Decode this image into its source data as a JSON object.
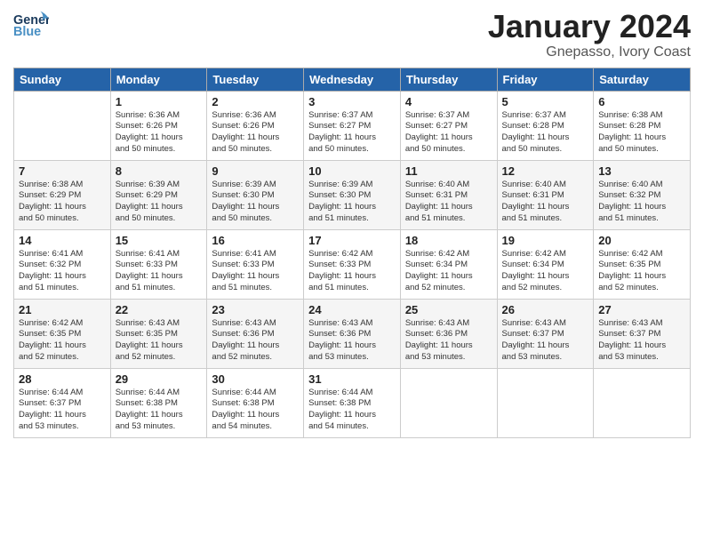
{
  "header": {
    "logo_general": "General",
    "logo_blue": "Blue",
    "title": "January 2024",
    "subtitle": "Gnepasso, Ivory Coast"
  },
  "columns": [
    "Sunday",
    "Monday",
    "Tuesday",
    "Wednesday",
    "Thursday",
    "Friday",
    "Saturday"
  ],
  "weeks": [
    [
      {
        "day": "",
        "info": ""
      },
      {
        "day": "1",
        "info": "Sunrise: 6:36 AM\nSunset: 6:26 PM\nDaylight: 11 hours\nand 50 minutes."
      },
      {
        "day": "2",
        "info": "Sunrise: 6:36 AM\nSunset: 6:26 PM\nDaylight: 11 hours\nand 50 minutes."
      },
      {
        "day": "3",
        "info": "Sunrise: 6:37 AM\nSunset: 6:27 PM\nDaylight: 11 hours\nand 50 minutes."
      },
      {
        "day": "4",
        "info": "Sunrise: 6:37 AM\nSunset: 6:27 PM\nDaylight: 11 hours\nand 50 minutes."
      },
      {
        "day": "5",
        "info": "Sunrise: 6:37 AM\nSunset: 6:28 PM\nDaylight: 11 hours\nand 50 minutes."
      },
      {
        "day": "6",
        "info": "Sunrise: 6:38 AM\nSunset: 6:28 PM\nDaylight: 11 hours\nand 50 minutes."
      }
    ],
    [
      {
        "day": "7",
        "info": "Sunrise: 6:38 AM\nSunset: 6:29 PM\nDaylight: 11 hours\nand 50 minutes."
      },
      {
        "day": "8",
        "info": "Sunrise: 6:39 AM\nSunset: 6:29 PM\nDaylight: 11 hours\nand 50 minutes."
      },
      {
        "day": "9",
        "info": "Sunrise: 6:39 AM\nSunset: 6:30 PM\nDaylight: 11 hours\nand 50 minutes."
      },
      {
        "day": "10",
        "info": "Sunrise: 6:39 AM\nSunset: 6:30 PM\nDaylight: 11 hours\nand 51 minutes."
      },
      {
        "day": "11",
        "info": "Sunrise: 6:40 AM\nSunset: 6:31 PM\nDaylight: 11 hours\nand 51 minutes."
      },
      {
        "day": "12",
        "info": "Sunrise: 6:40 AM\nSunset: 6:31 PM\nDaylight: 11 hours\nand 51 minutes."
      },
      {
        "day": "13",
        "info": "Sunrise: 6:40 AM\nSunset: 6:32 PM\nDaylight: 11 hours\nand 51 minutes."
      }
    ],
    [
      {
        "day": "14",
        "info": "Sunrise: 6:41 AM\nSunset: 6:32 PM\nDaylight: 11 hours\nand 51 minutes."
      },
      {
        "day": "15",
        "info": "Sunrise: 6:41 AM\nSunset: 6:33 PM\nDaylight: 11 hours\nand 51 minutes."
      },
      {
        "day": "16",
        "info": "Sunrise: 6:41 AM\nSunset: 6:33 PM\nDaylight: 11 hours\nand 51 minutes."
      },
      {
        "day": "17",
        "info": "Sunrise: 6:42 AM\nSunset: 6:33 PM\nDaylight: 11 hours\nand 51 minutes."
      },
      {
        "day": "18",
        "info": "Sunrise: 6:42 AM\nSunset: 6:34 PM\nDaylight: 11 hours\nand 52 minutes."
      },
      {
        "day": "19",
        "info": "Sunrise: 6:42 AM\nSunset: 6:34 PM\nDaylight: 11 hours\nand 52 minutes."
      },
      {
        "day": "20",
        "info": "Sunrise: 6:42 AM\nSunset: 6:35 PM\nDaylight: 11 hours\nand 52 minutes."
      }
    ],
    [
      {
        "day": "21",
        "info": "Sunrise: 6:42 AM\nSunset: 6:35 PM\nDaylight: 11 hours\nand 52 minutes."
      },
      {
        "day": "22",
        "info": "Sunrise: 6:43 AM\nSunset: 6:35 PM\nDaylight: 11 hours\nand 52 minutes."
      },
      {
        "day": "23",
        "info": "Sunrise: 6:43 AM\nSunset: 6:36 PM\nDaylight: 11 hours\nand 52 minutes."
      },
      {
        "day": "24",
        "info": "Sunrise: 6:43 AM\nSunset: 6:36 PM\nDaylight: 11 hours\nand 53 minutes."
      },
      {
        "day": "25",
        "info": "Sunrise: 6:43 AM\nSunset: 6:36 PM\nDaylight: 11 hours\nand 53 minutes."
      },
      {
        "day": "26",
        "info": "Sunrise: 6:43 AM\nSunset: 6:37 PM\nDaylight: 11 hours\nand 53 minutes."
      },
      {
        "day": "27",
        "info": "Sunrise: 6:43 AM\nSunset: 6:37 PM\nDaylight: 11 hours\nand 53 minutes."
      }
    ],
    [
      {
        "day": "28",
        "info": "Sunrise: 6:44 AM\nSunset: 6:37 PM\nDaylight: 11 hours\nand 53 minutes."
      },
      {
        "day": "29",
        "info": "Sunrise: 6:44 AM\nSunset: 6:38 PM\nDaylight: 11 hours\nand 53 minutes."
      },
      {
        "day": "30",
        "info": "Sunrise: 6:44 AM\nSunset: 6:38 PM\nDaylight: 11 hours\nand 54 minutes."
      },
      {
        "day": "31",
        "info": "Sunrise: 6:44 AM\nSunset: 6:38 PM\nDaylight: 11 hours\nand 54 minutes."
      },
      {
        "day": "",
        "info": ""
      },
      {
        "day": "",
        "info": ""
      },
      {
        "day": "",
        "info": ""
      }
    ]
  ]
}
